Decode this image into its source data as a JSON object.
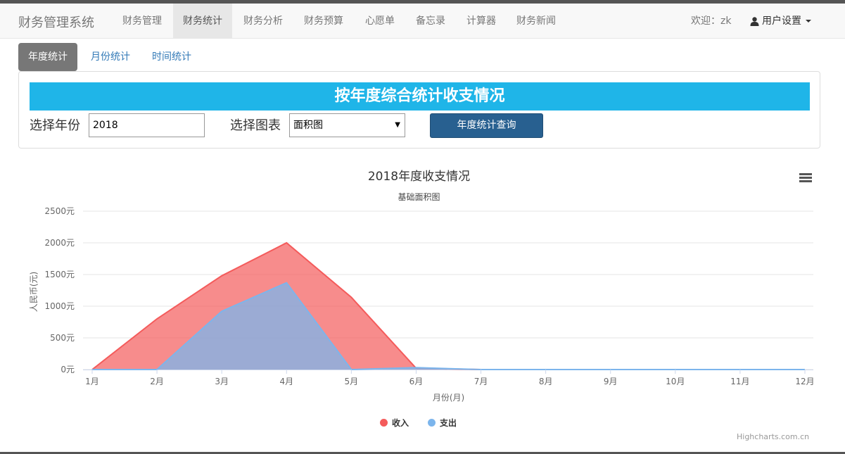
{
  "navbar": {
    "brand": "财务管理系统",
    "items": [
      {
        "label": "财务管理",
        "active": false
      },
      {
        "label": "财务统计",
        "active": true
      },
      {
        "label": "财务分析",
        "active": false
      },
      {
        "label": "财务预算",
        "active": false
      },
      {
        "label": "心愿单",
        "active": false
      },
      {
        "label": "备忘录",
        "active": false
      },
      {
        "label": "计算器",
        "active": false
      },
      {
        "label": "财务新闻",
        "active": false
      }
    ],
    "welcome": "欢迎：zk",
    "user_menu": "用户设置"
  },
  "tabs": [
    {
      "label": "年度统计",
      "active": true
    },
    {
      "label": "月份统计",
      "active": false
    },
    {
      "label": "时间统计",
      "active": false
    }
  ],
  "panel": {
    "banner": "按年度综合统计收支情况",
    "year_label": "选择年份",
    "year_value": "2018",
    "chart_label": "选择图表",
    "chart_value": "面积图",
    "query_button": "年度统计查询"
  },
  "colors": {
    "income": "#f45b5b",
    "expense": "#7cb5ec",
    "banner": "#1fb5e8",
    "button": "#286090"
  },
  "chart_data": {
    "type": "area",
    "title": "2018年度收支情况",
    "subtitle": "基础面积图",
    "xlabel": "月份(月)",
    "ylabel": "人民币(元)",
    "categories": [
      "1月",
      "2月",
      "3月",
      "4月",
      "5月",
      "6月",
      "7月",
      "8月",
      "9月",
      "10月",
      "11月",
      "12月"
    ],
    "ylim": [
      0,
      2500
    ],
    "yticks": [
      "0元",
      "500元",
      "1000元",
      "1500元",
      "2000元",
      "2500元"
    ],
    "series": [
      {
        "name": "收入",
        "values": [
          0,
          800,
          1480,
          2000,
          1140,
          20,
          0,
          0,
          0,
          0,
          0,
          0
        ]
      },
      {
        "name": "支出",
        "values": [
          0,
          0,
          920,
          1370,
          0,
          30,
          0,
          0,
          0,
          0,
          0,
          0
        ]
      }
    ],
    "legend": "bottom-center",
    "grid": true,
    "credits": "Highcharts.com.cn"
  }
}
